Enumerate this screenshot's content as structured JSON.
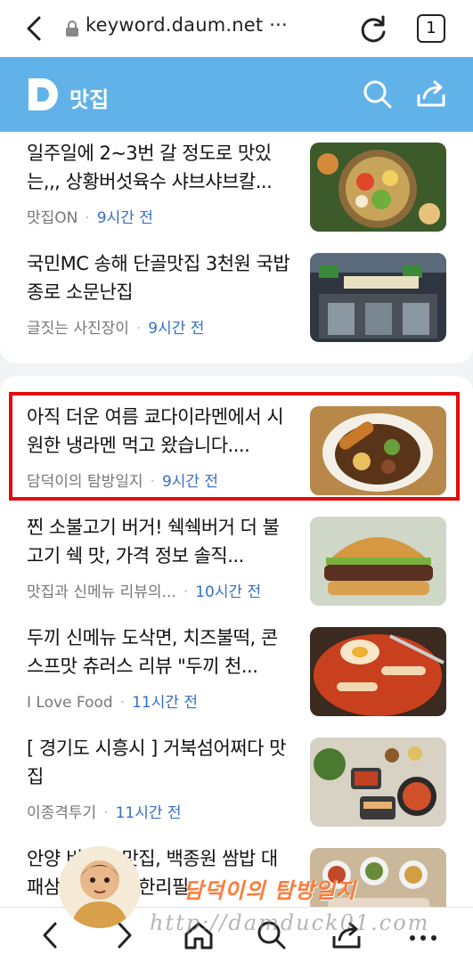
{
  "browser": {
    "url": "keyword.daum.net ···",
    "tab_count": "1"
  },
  "header": {
    "logo_letter": "D",
    "title": "맛집"
  },
  "articles_top": [
    {
      "title": "일주일에 2~3번 갈 정도로 맛있는,,, 상황버섯육수 샤브샤브칼...",
      "source": "맛집ON",
      "time": "9시간 전",
      "thumb_icon": "shabu-hotpot-photo"
    },
    {
      "title": "국민MC 송해 단골맛집 3천원 국밥 종로 소문난집",
      "source": "글짓는 사진장이",
      "time": "9시간 전",
      "thumb_icon": "restaurant-storefront-photo"
    }
  ],
  "articles_main": [
    {
      "title": "아직 더운 여름 쿄다이라멘에서 시원한 냉라멘 먹고 왔습니다....",
      "source": "담덕이의 탐방일지",
      "time": "9시간 전",
      "thumb_icon": "ramen-bowl-photo",
      "highlighted": true
    },
    {
      "title": "찐 소불고기 버거! 쉑쉑버거 더 불고기 쉑 맛, 가격 정보 솔직...",
      "source": "맛집과 신메뉴 리뷰의...",
      "time": "10시간 전",
      "thumb_icon": "burger-photo"
    },
    {
      "title": "두끼 신메뉴 도삭면, 치즈불떡, 콘스프맛 츄러스 리뷰 \"두끼 천...",
      "source": "I Love Food",
      "time": "11시간 전",
      "thumb_icon": "tteokbokki-photo"
    },
    {
      "title": "[ 경기도 시흥시 ] 거북섬어쩌다 맛집",
      "source": "이종격투기",
      "time": "11시간 전",
      "thumb_icon": "korean-table-photo"
    },
    {
      "title": "안양 비산골 맛집, 백종원 쌈밥 대패삼겹살 가 무한리필",
      "source": "",
      "time": "",
      "thumb_icon": "ssambap-photo"
    }
  ],
  "watermark": {
    "name": "담덕이의 탐방일지",
    "url": "http://damduck01.com"
  },
  "colors": {
    "header_bg": "#62b2ea",
    "time_text": "#3470c6",
    "highlight_border": "#e20d0d"
  }
}
